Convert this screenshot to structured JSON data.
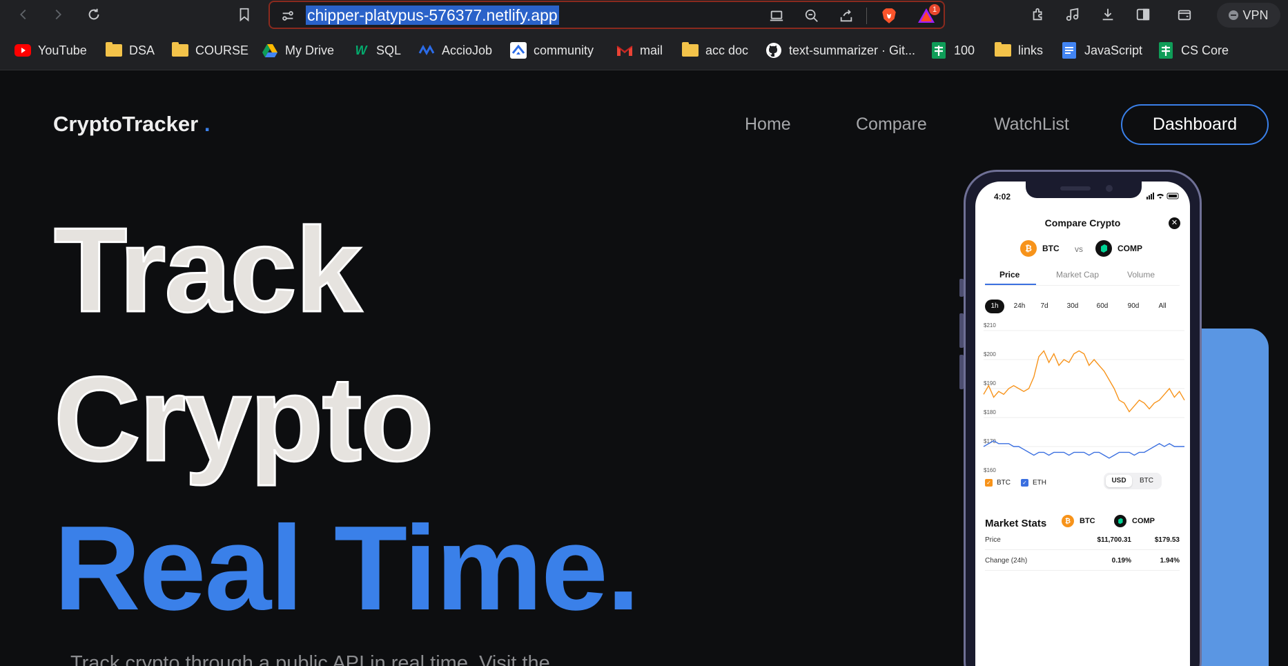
{
  "browser": {
    "url": "chipper-platypus-576377.netlify.app",
    "notification_count": "1",
    "vpn_label": "VPN",
    "bookmarks": [
      {
        "label": "YouTube",
        "icon": "youtube-icon"
      },
      {
        "label": "DSA",
        "icon": "folder-icon"
      },
      {
        "label": "COURSE",
        "icon": "folder-icon"
      },
      {
        "label": "My Drive",
        "icon": "google-drive-icon"
      },
      {
        "label": "SQL",
        "icon": "w3schools-icon"
      },
      {
        "label": "AccioJob",
        "icon": "acciojob-icon"
      },
      {
        "label": "community",
        "icon": "community-icon"
      },
      {
        "label": "mail",
        "icon": "gmail-icon"
      },
      {
        "label": "acc doc",
        "icon": "folder-icon"
      },
      {
        "label": "text-summarizer · Git...",
        "icon": "github-icon"
      },
      {
        "label": "100",
        "icon": "google-sheets-icon"
      },
      {
        "label": "links",
        "icon": "folder-icon"
      },
      {
        "label": "JavaScript",
        "icon": "google-docs-icon"
      },
      {
        "label": "CS Core",
        "icon": "google-sheets-icon"
      }
    ]
  },
  "site": {
    "logo": "CryptoTracker",
    "logo_dot": ".",
    "nav": {
      "home": "Home",
      "compare": "Compare",
      "watchlist": "WatchList",
      "dashboard": "Dashboard"
    },
    "hero": {
      "line1": "Track",
      "line2": "Crypto",
      "line3": "Real Time.",
      "subtitle": "Track crypto through a public API in real time. Visit the"
    }
  },
  "phone": {
    "time": "4:02",
    "title": "Compare Crypto",
    "coin_a": "BTC",
    "vs": "vs",
    "coin_b": "COMP",
    "tabs": [
      "Price",
      "Market Cap",
      "Volume"
    ],
    "ranges": [
      "1h",
      "24h",
      "7d",
      "30d",
      "60d",
      "90d",
      "All"
    ],
    "active_range": "1h",
    "legend": [
      "BTC",
      "ETH"
    ],
    "currency_toggle": [
      "USD",
      "BTC"
    ],
    "market_stats": {
      "title": "Market Stats",
      "coin_a": "BTC",
      "coin_b": "COMP",
      "rows": [
        {
          "label": "Price",
          "a": "$11,700.31",
          "b": "$179.53"
        },
        {
          "label": "Change (24h)",
          "a": "0.19%",
          "b": "1.94%"
        }
      ]
    },
    "colors": {
      "btc": "#f7931a",
      "eth": "#3a6fe0",
      "comp": "#00d395"
    }
  },
  "chart_data": {
    "type": "line",
    "y_ticks": [
      "$210",
      "$200",
      "$190",
      "$180",
      "$170",
      "$160"
    ],
    "ylim": [
      160,
      210
    ],
    "series": [
      {
        "name": "BTC",
        "values": [
          188,
          191,
          187,
          189,
          188,
          190,
          191,
          190,
          189,
          190,
          194,
          201,
          203,
          199,
          202,
          198,
          200,
          199,
          202,
          203,
          202,
          198,
          200,
          198,
          196,
          193,
          190,
          186,
          185,
          182,
          184,
          186,
          185,
          183,
          185,
          186,
          188,
          190,
          187,
          189,
          186
        ]
      },
      {
        "name": "ETH",
        "values": [
          170,
          171,
          172,
          171,
          171,
          171,
          170,
          170,
          169,
          168,
          167,
          168,
          168,
          167,
          168,
          168,
          168,
          167,
          168,
          168,
          168,
          167,
          168,
          168,
          167,
          166,
          167,
          168,
          168,
          168,
          167,
          168,
          168,
          169,
          170,
          171,
          170,
          171,
          170,
          170,
          170
        ]
      }
    ]
  }
}
